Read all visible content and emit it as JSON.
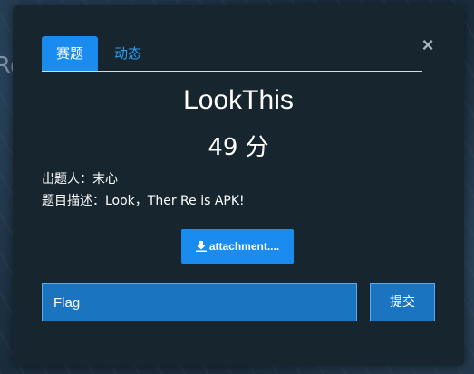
{
  "background": {
    "glyph": "Re"
  },
  "modal": {
    "close_icon": "×",
    "tabs": [
      {
        "label": "赛题",
        "active": true
      },
      {
        "label": "动态",
        "active": false
      }
    ],
    "challenge": {
      "name": "LookThis",
      "points": "49 分",
      "author": "出题人：末心",
      "description": "题目描述：Look，Ther Re is APK!"
    },
    "attachment": {
      "label": "attachment....",
      "icon": "download-icon"
    },
    "flag": {
      "placeholder": "Flag",
      "value": ""
    },
    "submit_label": "提交"
  },
  "colors": {
    "accent": "#1a8cf0",
    "input_bg": "#1a74c0",
    "modal_bg": "#16252e"
  }
}
